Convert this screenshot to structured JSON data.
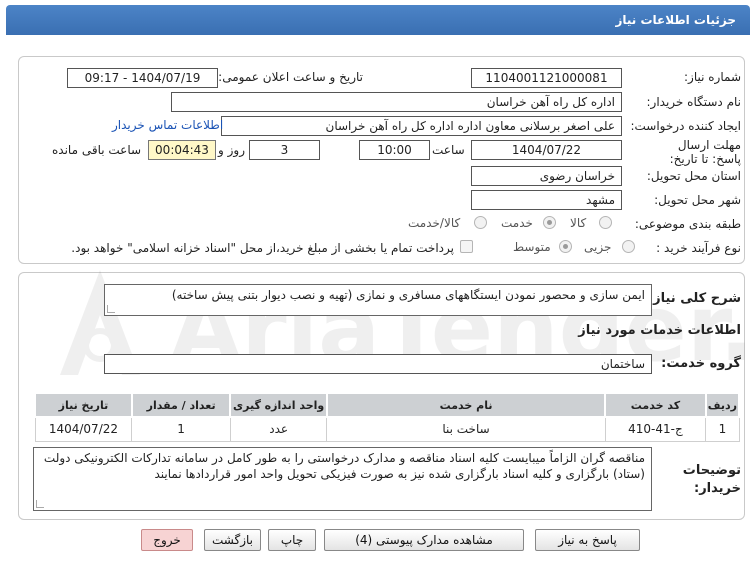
{
  "header": {
    "title": "جزئیات اطلاعات نیاز"
  },
  "form": {
    "need_number_label": "شماره نیاز:",
    "need_number": "1104001121000081",
    "announce_label": "تاریخ و ساعت اعلان عمومی:",
    "announce_value": "1404/07/19 - 09:17",
    "buyer_label": "نام دستگاه خریدار:",
    "buyer_value": "اداره کل راه آهن خراسان",
    "creator_label": "ایجاد کننده درخواست:",
    "creator_value": "علی اصغر برسلانی معاون اداره اداره کل راه آهن خراسان",
    "contact_link": "اطلاعات تماس خریدار",
    "deadline_label": "مهلت ارسال پاسخ: تا تاریخ:",
    "deadline_date": "1404/07/22",
    "time_label": "ساعت",
    "deadline_time": "10:00",
    "days_value": "3",
    "days_label": "روز و",
    "remaining_time": "00:04:43",
    "remaining_label": "ساعت باقی مانده",
    "province_label": "استان محل تحویل:",
    "province_value": "خراسان رضوی",
    "city_label": "شهر محل تحویل:",
    "city_value": "مشهد",
    "category_label": "طبقه بندی موضوعی:",
    "category_options": [
      "کالا",
      "خدمت",
      "کالا/خدمت"
    ],
    "category_selected": "خدمت",
    "process_label": "نوع فرآیند خرید :",
    "process_options": [
      "جزیی",
      "متوسط"
    ],
    "process_selected": "متوسط",
    "payment_note": "پرداخت تمام یا بخشی از مبلغ خرید،از محل \"اسناد خزانه اسلامی\" خواهد بود."
  },
  "details": {
    "description_label": "شرح کلی نیاز:",
    "description_value": "ایمن سازی و محصور نمودن ایستگاههای مسافری و نمازی (تهیه و نصب دیوار بتنی پیش ساخته)",
    "services_title": "اطلاعات خدمات مورد نیاز",
    "service_group_label": "گروه خدمت:",
    "service_group_value": "ساختمان",
    "table": {
      "headers": [
        "ردیف",
        "کد خدمت",
        "نام خدمت",
        "واحد اندازه گیری",
        "تعداد / مقدار",
        "تاریخ نیاز"
      ],
      "rows": [
        [
          "1",
          "ج-41-410",
          "ساخت بنا",
          "عدد",
          "1",
          "1404/07/22"
        ]
      ]
    },
    "buyer_notes_label": "توضیحات خریدار:",
    "buyer_notes_value": "مناقصه گران الزاماً میبایست کلیه اسناد مناقصه و مدارک درخواستی را به طور کامل در سامانه تدارکات الکترونیکی دولت (ستاد)  بارگزاری و کلیه اسناد بارگزاری شده نیز به صورت فیزیکی تحویل واحد امور قراردادها نمایند"
  },
  "buttons": {
    "reply": "پاسخ به نیاز",
    "attachments": "مشاهده مدارک پیوستی (4)",
    "print": "چاپ",
    "back": "بازگشت",
    "exit": "خروج"
  },
  "watermark": {
    "text": "AriaTender.net"
  },
  "colors": {
    "header": "#3f76ba",
    "link": "#1a53b5",
    "timer_bg": "#fff8c8",
    "exit_bg": "#f7d3d3"
  }
}
